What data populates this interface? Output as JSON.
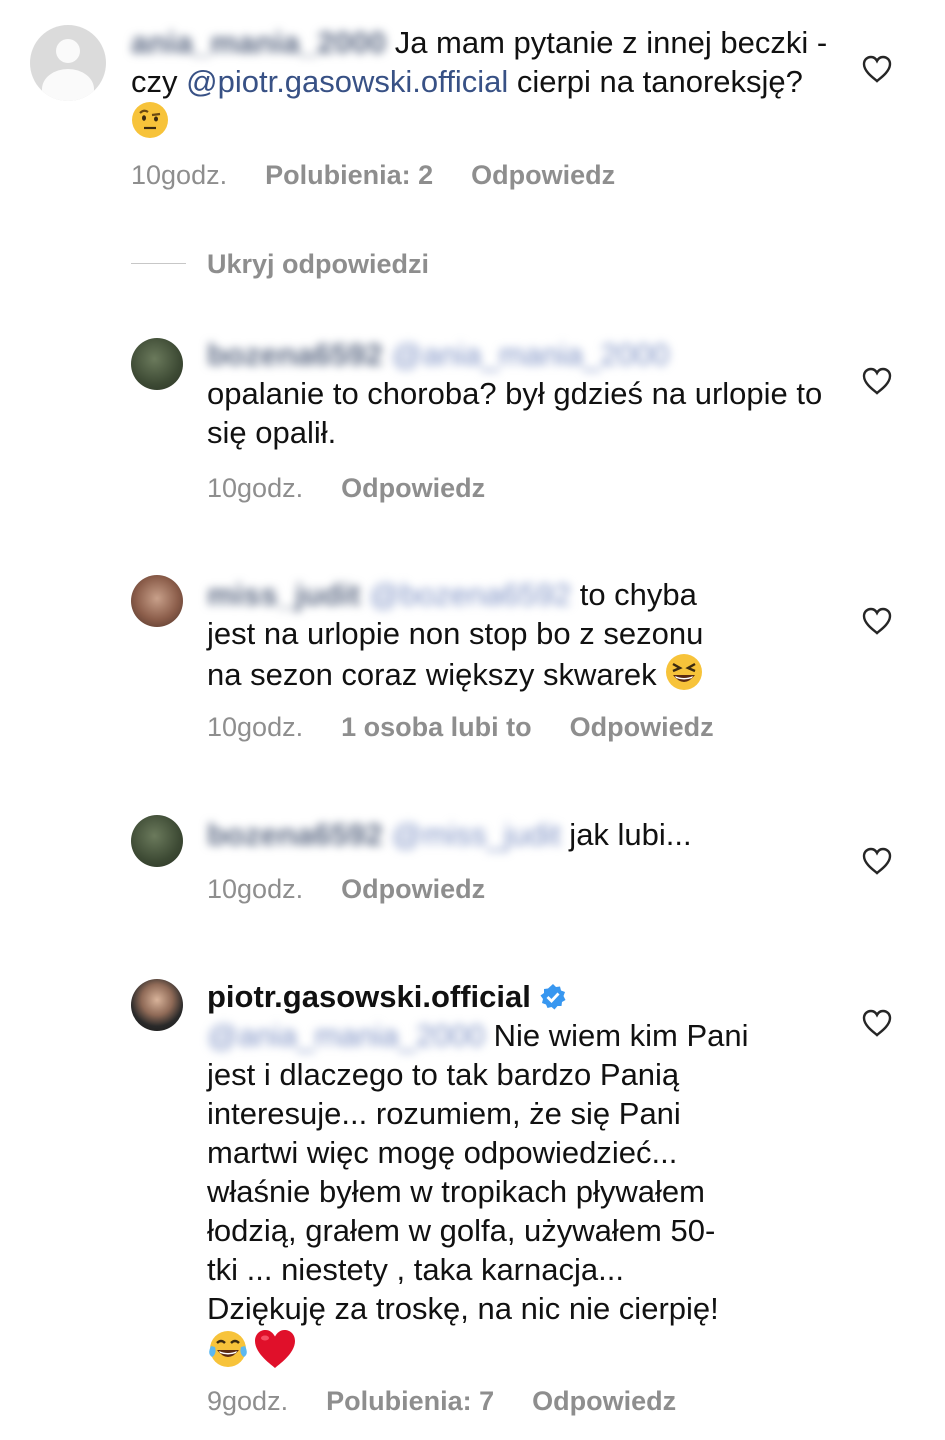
{
  "comments": [
    {
      "username": "ania_mania_2000",
      "text_before": " Ja mam pytanie z innej beczki - czy ",
      "mention": "@piotr.gasowski.official",
      "text_after": " cierpi na tanoreksję? ",
      "emoji": "raised-eyebrow-face-emoji",
      "time": "10godz.",
      "likes": "Polubienia: 2",
      "reply": "Odpowiedz"
    },
    {
      "username": "bozena6592",
      "mention": "@ania_mania_2000",
      "text": "opalanie to choroba? był gdzieś na urlopie to się opalił.",
      "time": "10godz.",
      "reply": "Odpowiedz"
    },
    {
      "username": "miss_judit",
      "mention": "@bozena6592",
      "text_line1": " to chyba",
      "text_line2": "jest na urlopie non stop bo z sezonu",
      "text_line3": "na sezon coraz większy skwarek ",
      "emoji": "grinning-squinting-face-emoji",
      "time": "10godz.",
      "likes": "1 osoba lubi to",
      "reply": "Odpowiedz"
    },
    {
      "username": "bozena6592",
      "mention": "@miss_judit",
      "text": " jak lubi...",
      "time": "10godz.",
      "reply": "Odpowiedz"
    },
    {
      "username": "piotr.gasowski.official",
      "verified_icon": "verified-badge-icon",
      "mention": "@ania_mania_2000",
      "line1": " Nie wiem kim Pani",
      "line2": "jest i dlaczego to tak bardzo Panią",
      "line3": "interesuje... rozumiem, że się Pani",
      "line4": "martwi więc mogę odpowiedzieć...",
      "line5": "właśnie byłem w tropikach  pływałem",
      "line6": "łodzią,  grałem w golfa, używałem 50-",
      "line7": "tki ... niestety , taka karnacja...",
      "line8": "Dziękuję za troskę, na nic nie cierpię!",
      "emojis": [
        "tears-of-joy-emoji",
        "red-heart-emoji"
      ],
      "time": "9godz.",
      "likes": "Polubienia: 7",
      "reply": "Odpowiedz"
    }
  ],
  "hide_replies": "Ukryj odpowiedzi",
  "colors": {
    "text": "#111111",
    "meta": "#8e8e8e",
    "mention": "#385185",
    "verified": "#3897f0",
    "heart_emoji": "#e0102a",
    "emoji_yellow": "#f7c33a"
  }
}
